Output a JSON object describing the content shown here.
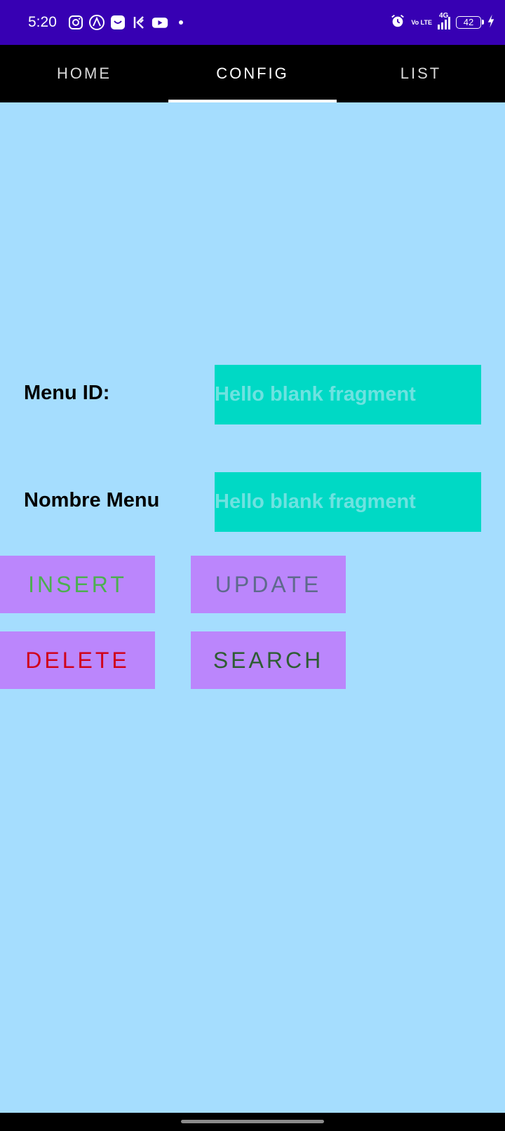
{
  "status_bar": {
    "time": "5:20",
    "left_icons": [
      "instagram-icon",
      "arc-icon",
      "shopping-bag-icon",
      "kite-icon",
      "youtube-icon",
      "dot-icon"
    ],
    "volte": "Vo LTE",
    "network": "4G",
    "battery": "42"
  },
  "tabs": [
    {
      "label": "HOME",
      "active": false
    },
    {
      "label": "CONFIG",
      "active": true
    },
    {
      "label": "LIST",
      "active": false
    }
  ],
  "form": {
    "menu_id_label": "Menu ID:",
    "menu_id_value": "Hello blank fragment",
    "nombre_label": "Nombre Menu",
    "nombre_value": "Hello blank fragment"
  },
  "buttons": {
    "insert": "INSERT",
    "update": "UPDATE",
    "delete": "DELETE",
    "search": "SEARCH"
  },
  "colors": {
    "status_bar": "#3700b3",
    "background": "#a5ddfe",
    "field": "#00d9c5",
    "button": "#bb86fc",
    "insert_text": "#4caf50",
    "update_text": "#5e6a8c",
    "delete_text": "#d0021b",
    "search_text": "#2e5d33"
  }
}
